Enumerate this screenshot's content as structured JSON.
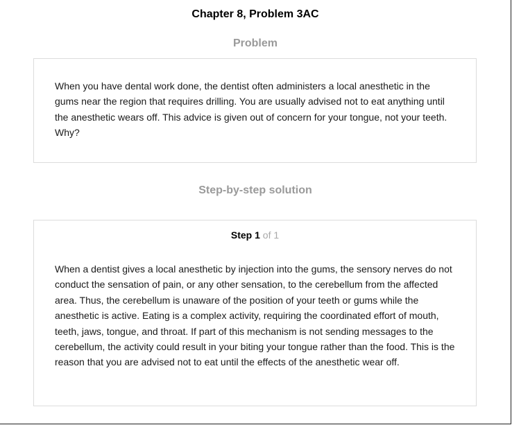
{
  "header": {
    "title": "Chapter 8, Problem 3AC"
  },
  "problem": {
    "heading": "Problem",
    "text": "When you have dental work done, the dentist often administers a local anesthetic in the gums near the region that requires drilling. You are usually advised not to eat anything until the anesthetic wears off. This advice is given out of concern for your tongue, not your teeth. Why?"
  },
  "solution": {
    "heading": "Step-by-step solution",
    "step_word": "Step",
    "step_number": "1",
    "step_total": "of 1",
    "text": "When a dentist gives a local anesthetic by injection into the gums, the sensory nerves do not conduct the sensation of pain, or any other sensation, to the cerebellum from the affected area. Thus, the cerebellum is unaware of the position of your teeth or gums while the anesthetic is active. Eating is a complex activity, requiring the coordinated effort of mouth, teeth, jaws, tongue, and throat. If part of this mechanism is not sending messages to the cerebellum, the activity could result in your biting your tongue rather than the food. This is the reason that you are advised not to eat until the effects of the anesthetic wear off."
  }
}
